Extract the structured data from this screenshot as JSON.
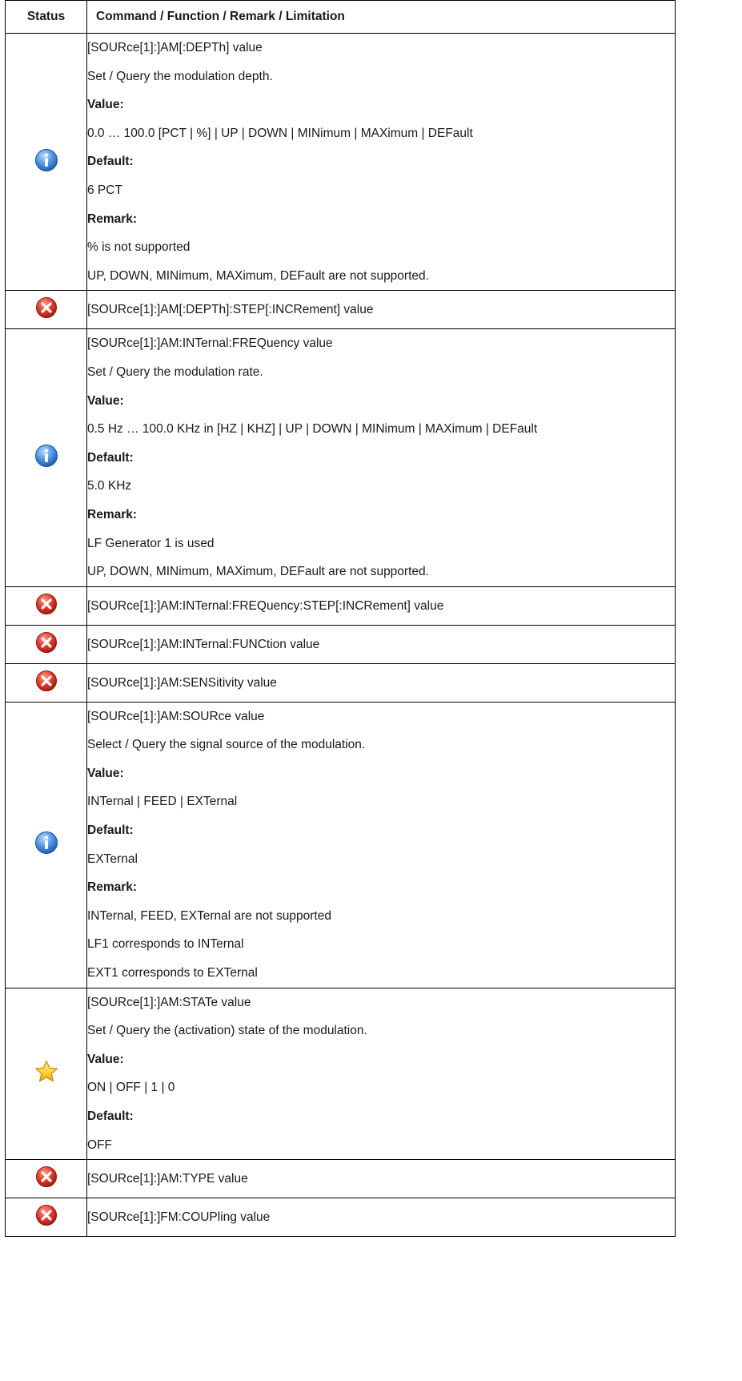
{
  "header": {
    "status": "Status",
    "command": "Command / Function / Remark / Limitation"
  },
  "rows": [
    {
      "status_icon": "info-icon",
      "lines": [
        "[SOURce[1]:]AM[:DEPTh] value",
        "Set / Query the modulation depth.",
        "Value:",
        "0.0 … 100.0 [PCT | %] | UP | DOWN | MINimum | MAXimum | DEFault",
        "Default:",
        "6 PCT",
        "Remark:",
        "% is not supported",
        "UP, DOWN, MINimum, MAXimum, DEFault are not supported."
      ]
    },
    {
      "status_icon": "not-supported-icon",
      "lines": [
        "[SOURce[1]:]AM[:DEPTh]:STEP[:INCRement] value"
      ]
    },
    {
      "status_icon": "info-icon",
      "lines": [
        "[SOURce[1]:]AM:INTernal:FREQuency value",
        "Set / Query the modulation rate.",
        "Value:",
        "0.5 Hz … 100.0 KHz in [HZ | KHZ] | UP | DOWN | MINimum | MAXimum | DEFault",
        "Default:",
        "5.0 KHz",
        "Remark:",
        "LF Generator 1 is used",
        "UP, DOWN, MINimum, MAXimum, DEFault are not supported."
      ]
    },
    {
      "status_icon": "not-supported-icon",
      "lines": [
        "[SOURce[1]:]AM:INTernal:FREQuency:STEP[:INCRement] value"
      ]
    },
    {
      "status_icon": "not-supported-icon",
      "lines": [
        "[SOURce[1]:]AM:INTernal:FUNCtion value"
      ]
    },
    {
      "status_icon": "not-supported-icon",
      "lines": [
        "[SOURce[1]:]AM:SENSitivity value"
      ]
    },
    {
      "status_icon": "info-icon",
      "lines": [
        "[SOURce[1]:]AM:SOURce value",
        "Select / Query the signal source of the modulation.",
        "Value:",
        "INTernal | FEED | EXTernal",
        "Default:",
        "EXTernal",
        "Remark:",
        "INTernal, FEED, EXTernal are not supported",
        "LF1 corresponds to INTernal",
        "EXT1 corresponds to EXTernal"
      ]
    },
    {
      "status_icon": "star-icon",
      "lines": [
        "[SOURce[1]:]AM:STATe value",
        "Set / Query the (activation) state of the modulation.",
        "Value:",
        "ON | OFF | 1 | 0",
        "Default:",
        "OFF"
      ]
    },
    {
      "status_icon": "not-supported-icon",
      "lines": [
        "[SOURce[1]:]AM:TYPE value"
      ]
    },
    {
      "status_icon": "not-supported-icon",
      "lines": [
        "[SOURce[1]:]FM:COUPling value"
      ]
    }
  ]
}
